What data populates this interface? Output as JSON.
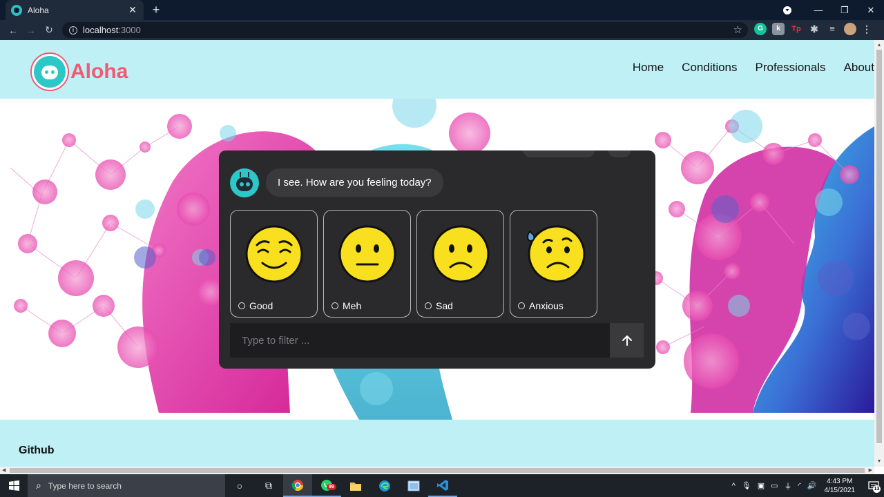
{
  "browser": {
    "tab_title": "Aloha",
    "tab_close": "✕",
    "new_tab": "+",
    "url_host": "localhost",
    "url_port": ":3000",
    "win_min": "—",
    "win_max": "❐",
    "win_close": "✕"
  },
  "site": {
    "logo_text": "Aloha",
    "nav": [
      "Home",
      "Conditions",
      "Professionals",
      "About"
    ],
    "footer_link": "Github"
  },
  "chat": {
    "bot_message": "I see. How are you feeling today?",
    "options": [
      {
        "label": "Good",
        "icon": "relieved-face-icon"
      },
      {
        "label": "Meh",
        "icon": "neutral-face-icon"
      },
      {
        "label": "Sad",
        "icon": "frowning-face-icon"
      },
      {
        "label": "Anxious",
        "icon": "anxious-sweat-face-icon"
      }
    ],
    "filter_placeholder": "Type to filter ..."
  },
  "taskbar": {
    "search_placeholder": "Type here to search",
    "whatsapp_badge": "99",
    "time": "4:43 PM",
    "date": "4/15/2021",
    "notifications_count": "13"
  },
  "colors": {
    "header_bg": "#bff0f6",
    "brand": "#f05a72",
    "teal": "#2cc7c7",
    "chat_bg": "#2a2a2c",
    "emoji_yellow": "#f8e01e"
  }
}
